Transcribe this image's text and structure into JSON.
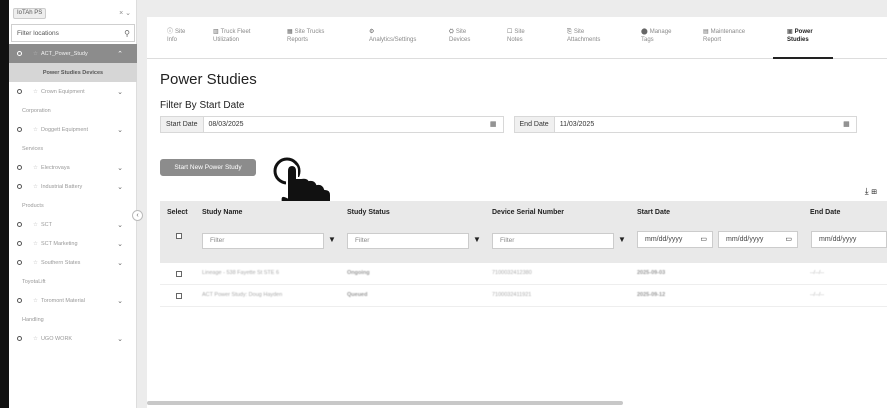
{
  "sidebar": {
    "location_chip": "IoTAh PS",
    "location_chip_controls": "× ⌄",
    "filter_placeholder": "Filter locations",
    "tree": [
      {
        "label": "ACT_Power_Study",
        "kind": "active"
      },
      {
        "label": "Power Studies Devices",
        "kind": "sub"
      },
      {
        "label": "Crown Equipment",
        "kind": "node"
      },
      {
        "label": "Corporation",
        "kind": "wrap"
      },
      {
        "label": "Doggett Equipment",
        "kind": "node"
      },
      {
        "label": "Services",
        "kind": "wrap"
      },
      {
        "label": "Electrovaya",
        "kind": "node"
      },
      {
        "label": "Industrial Battery",
        "kind": "node"
      },
      {
        "label": "Products",
        "kind": "wrap"
      },
      {
        "label": "SCT",
        "kind": "node"
      },
      {
        "label": "SCT Marketing",
        "kind": "node"
      },
      {
        "label": "Southern States",
        "kind": "node"
      },
      {
        "label": "ToyotaLift",
        "kind": "wrap"
      },
      {
        "label": "Toromont Material",
        "kind": "node"
      },
      {
        "label": "Handling",
        "kind": "wrap"
      },
      {
        "label": "UGO WORK",
        "kind": "node"
      }
    ]
  },
  "tabs": [
    {
      "icon": "ⓘ",
      "l1": "Site",
      "l2": "Info"
    },
    {
      "icon": "▥",
      "l1": "Truck Fleet",
      "l2": "Utilization"
    },
    {
      "icon": "▦",
      "l1": "Site Trucks",
      "l2": "Reports"
    },
    {
      "icon": "⚙",
      "l1": "",
      "l2": "Analytics/Settings"
    },
    {
      "icon": "⛭",
      "l1": "Site",
      "l2": "Devices"
    },
    {
      "icon": "☐",
      "l1": "Site",
      "l2": "Notes"
    },
    {
      "icon": "⎘",
      "l1": "Site",
      "l2": "Attachments"
    },
    {
      "icon": "⬤",
      "l1": "Manage",
      "l2": "Tags"
    },
    {
      "icon": "▤",
      "l1": "Maintenance",
      "l2": "Report"
    },
    {
      "icon": "▣",
      "l1": "Power",
      "l2": "Studies"
    }
  ],
  "page": {
    "title": "Power Studies",
    "filter_title": "Filter By Start Date",
    "start_date_label": "Start Date",
    "start_date_value": "08/03/2025",
    "end_date_label": "End Date",
    "end_date_value": "11/03/2025",
    "start_button": "Start New Power Study"
  },
  "table": {
    "headers": [
      "Select",
      "Study Name",
      "Study Status",
      "Device Serial Number",
      "Start Date",
      "End Date"
    ],
    "filter_placeholder": "Filter",
    "date_placeholder": "mm/dd/yyyy",
    "rows": [
      [
        "Lineage - 538 Fayette St STE 6",
        "Ongoing",
        "7100032412380",
        "2025-09-03",
        "--/--/--"
      ],
      [
        "ACT Power Study: Doug Hayden",
        "Queued",
        "7100032411921",
        "2025-09-12",
        "--/--/--"
      ]
    ]
  }
}
